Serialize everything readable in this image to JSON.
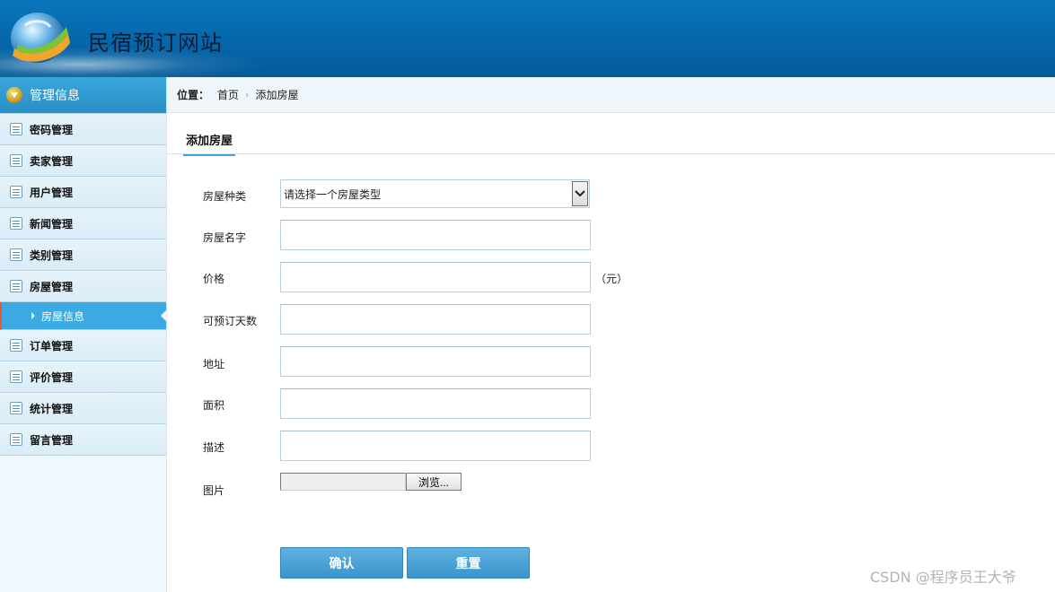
{
  "header": {
    "site_title": "民宿预订网站"
  },
  "sidebar": {
    "section_title": "管理信息",
    "items": [
      {
        "label": "密码管理"
      },
      {
        "label": "卖家管理"
      },
      {
        "label": "用户管理"
      },
      {
        "label": "新闻管理"
      },
      {
        "label": "类别管理"
      },
      {
        "label": "房屋管理"
      },
      {
        "label": "房屋信息",
        "active": true
      },
      {
        "label": "订单管理"
      },
      {
        "label": "评价管理"
      },
      {
        "label": "统计管理"
      },
      {
        "label": "留言管理"
      }
    ],
    "active_color": "#3ba9e2"
  },
  "breadcrumb": {
    "label": "位置：",
    "items": [
      "首页",
      "添加房屋"
    ]
  },
  "main": {
    "tab_title": "添加房屋",
    "form": {
      "house_type_label": "房屋种类",
      "house_type_selected": "请选择一个房屋类型",
      "name_label": "房屋名字",
      "price_label": "价格",
      "price_unit": "（元）",
      "days_label": "可预订天数",
      "address_label": "地址",
      "area_label": "面积",
      "description_label": "描述",
      "image_label": "图片",
      "browse_label": "浏览...",
      "confirm_label": "确认",
      "reset_label": "重置"
    }
  },
  "watermark": "CSDN @程序员王大爷",
  "colors": {
    "header": "#0565a8",
    "button": "#3a95cc",
    "accent": "#3aa2d9"
  }
}
